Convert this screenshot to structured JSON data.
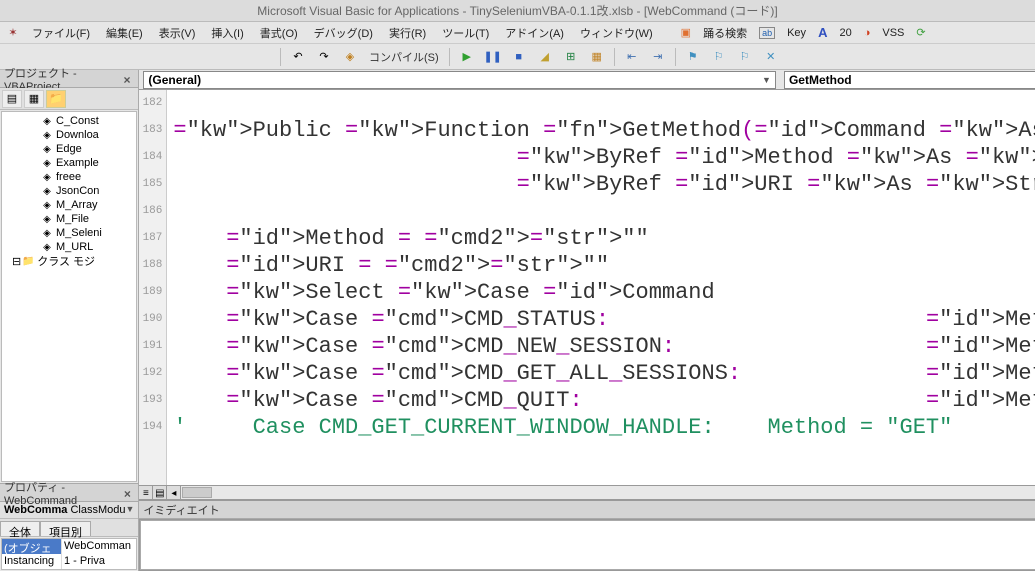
{
  "title": "Microsoft Visual Basic for Applications - TinySeleniumVBA-0.1.1改.xlsb - [WebCommand (コード)]",
  "menu": {
    "file": "ファイル(F)",
    "edit": "編集(E)",
    "view": "表示(V)",
    "insert": "挿入(I)",
    "format": "書式(O)",
    "debug": "デバッグ(D)",
    "run": "実行(R)",
    "tool": "ツール(T)",
    "addin": "アドイン(A)",
    "window": "ウィンドウ(W)",
    "odoru": "踊る検索",
    "key": "Key",
    "twenty": "20",
    "vss": "VSS"
  },
  "toolbar": {
    "compile": "コンパイル(S)"
  },
  "project": {
    "header": "プロジェクト - VBAProject",
    "items": [
      "C_Const",
      "Downloa",
      "Edge",
      "Example",
      "freee",
      "JsonCon",
      "M_Array",
      "M_File",
      "M_Seleni",
      "M_URL"
    ],
    "folder": "クラス モジ"
  },
  "props": {
    "header": "プロパティ - WebCommand",
    "class_hdr1": "WebComma",
    "class_hdr2": "ClassModu",
    "tab1": "全体",
    "tab2": "項目別",
    "rows": [
      {
        "k": "(オブジェ",
        "v": "WebComman"
      },
      {
        "k": "Instancing",
        "v": "1 - Priva"
      }
    ]
  },
  "code": {
    "dd_left": "(General)",
    "dd_right": "GetMethod",
    "line_start": 182,
    "lines": [
      "",
      "Public Function GetMethod(Command As E_WebDriverCommand, _",
      "                          ByRef Method As String, _",
      "                          ByRef URI As String) As Boolean",
      "",
      "    Method = \"\"",
      "    URI = \"\"",
      "    Select Case Command",
      "    Case CMD_STATUS:                        Method = \"GET\":",
      "    Case CMD_NEW_SESSION:                   Method = \"POST\"",
      "    Case CMD_GET_ALL_SESSIONS:              Method = \"GET\":",
      "    Case CMD_QUIT:                          Method = \"DELET",
      "'     Case CMD_GET_CURRENT_WINDOW_HANDLE:    Method = \"GET\""
    ]
  },
  "immediate": {
    "header": "イミディエイト"
  }
}
